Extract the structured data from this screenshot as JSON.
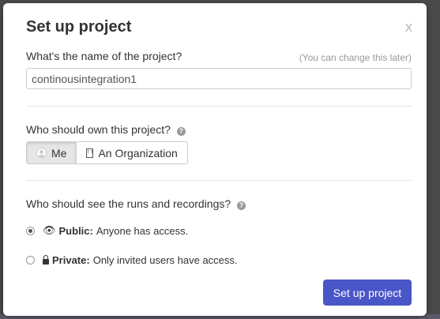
{
  "modal": {
    "title": "Set up project",
    "close_label": "x"
  },
  "project_name": {
    "question": "What's the name of the project?",
    "hint": "(You can change this later)",
    "value": "continousintegration1"
  },
  "owner": {
    "question": "Who should own this project?",
    "help_icon": "?",
    "options": [
      {
        "label": "Me",
        "icon": "user-icon",
        "selected": true
      },
      {
        "label": "An Organization",
        "icon": "building-icon",
        "selected": false
      }
    ]
  },
  "visibility": {
    "question": "Who should see the runs and recordings?",
    "help_icon": "?",
    "options": [
      {
        "icon": "eye-icon",
        "label": "Public:",
        "description": "Anyone has access.",
        "selected": true
      },
      {
        "icon": "lock-icon",
        "label": "Private:",
        "description": "Only invited users have access.",
        "selected": false
      }
    ]
  },
  "submit_label": "Set up project",
  "colors": {
    "primary_button": "#4956c7",
    "backdrop": "#4a4a4a"
  }
}
